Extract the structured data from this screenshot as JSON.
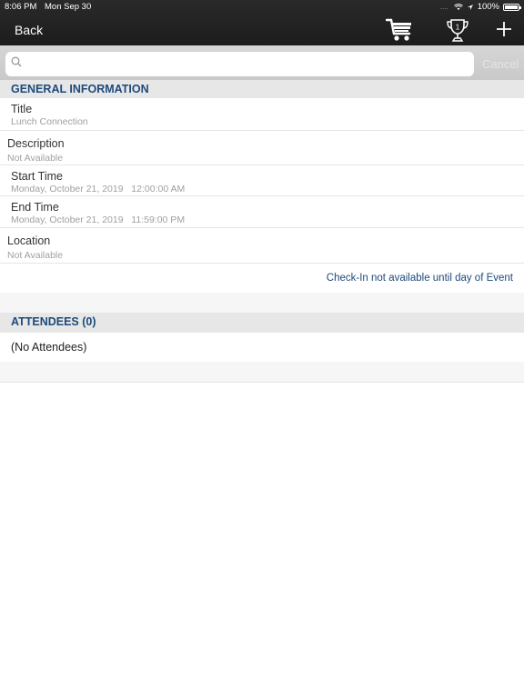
{
  "status_bar": {
    "time": "8:06 PM",
    "date": "Mon Sep 30",
    "battery": "100%"
  },
  "nav": {
    "back_label": "Back",
    "icons": [
      "cart-icon",
      "trophy-icon",
      "plus-icon"
    ],
    "trophy_count": "1"
  },
  "search": {
    "placeholder": "",
    "value": "",
    "cancel_label": "Cancel"
  },
  "general": {
    "header": "GENERAL INFORMATION",
    "fields": [
      {
        "label": "Title",
        "value": "Lunch Connection"
      },
      {
        "label": "Description",
        "value": "Not Available"
      },
      {
        "label": "Start Time",
        "value": "Monday, October 21, 2019   12:00:00 AM"
      },
      {
        "label": "End Time",
        "value": "Monday, October 21, 2019   11:59:00 PM"
      },
      {
        "label": "Location",
        "value": "Not Available"
      }
    ],
    "checkin_note": "Check-In not available until day of Event"
  },
  "attendees": {
    "header": "ATTENDEES (0)",
    "empty_text": "(No Attendees)"
  },
  "colors": {
    "accent": "#1d4a7a",
    "toolbar": "#1f1f1f",
    "section_bg": "#e7e7e7"
  }
}
